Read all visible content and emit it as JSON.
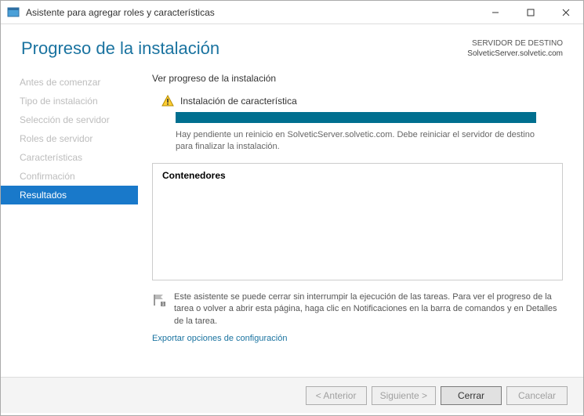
{
  "window": {
    "title": "Asistente para agregar roles y características"
  },
  "header": {
    "page_title": "Progreso de la instalación",
    "dest_label": "SERVIDOR DE DESTINO",
    "dest_server": "SolveticServer.solvetic.com"
  },
  "sidebar": {
    "items": [
      {
        "label": "Antes de comenzar",
        "active": false
      },
      {
        "label": "Tipo de instalación",
        "active": false
      },
      {
        "label": "Selección de servidor",
        "active": false
      },
      {
        "label": "Roles de servidor",
        "active": false
      },
      {
        "label": "Características",
        "active": false
      },
      {
        "label": "Confirmación",
        "active": false
      },
      {
        "label": "Resultados",
        "active": true
      }
    ]
  },
  "main": {
    "section_label": "Ver progreso de la instalación",
    "status_title": "Instalación de característica",
    "progress_percent": 100,
    "status_message": "Hay pendiente un reinicio en SolveticServer.solvetic.com. Debe reiniciar el servidor de destino para finalizar la instalación.",
    "result_feature": "Contenedores",
    "info_text": "Este asistente se puede cerrar sin interrumpir la ejecución de las tareas. Para ver el progreso de la tarea o volver a abrir esta página, haga clic en Notificaciones en la barra de comandos y en Detalles de la tarea.",
    "export_link": "Exportar opciones de configuración"
  },
  "footer": {
    "prev": "< Anterior",
    "next": "Siguiente >",
    "close": "Cerrar",
    "cancel": "Cancelar"
  }
}
